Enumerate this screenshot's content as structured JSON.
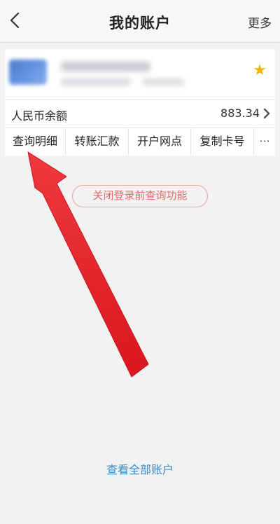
{
  "header": {
    "title": "我的账户",
    "more_label": "更多"
  },
  "account": {
    "balance_label": "人民币余额",
    "balance_value": "883.34",
    "favorite": true
  },
  "actions": [
    {
      "label": "查询明细"
    },
    {
      "label": "转账汇款"
    },
    {
      "label": "开户网点"
    },
    {
      "label": "复制卡号"
    },
    {
      "label": "···"
    }
  ],
  "close_query_button": "关闭登录前查询功能",
  "view_all_link": "查看全部账户",
  "colors": {
    "annotation_arrow": "#e8252d",
    "link": "#3a8bc8",
    "star": "#f4b400"
  }
}
